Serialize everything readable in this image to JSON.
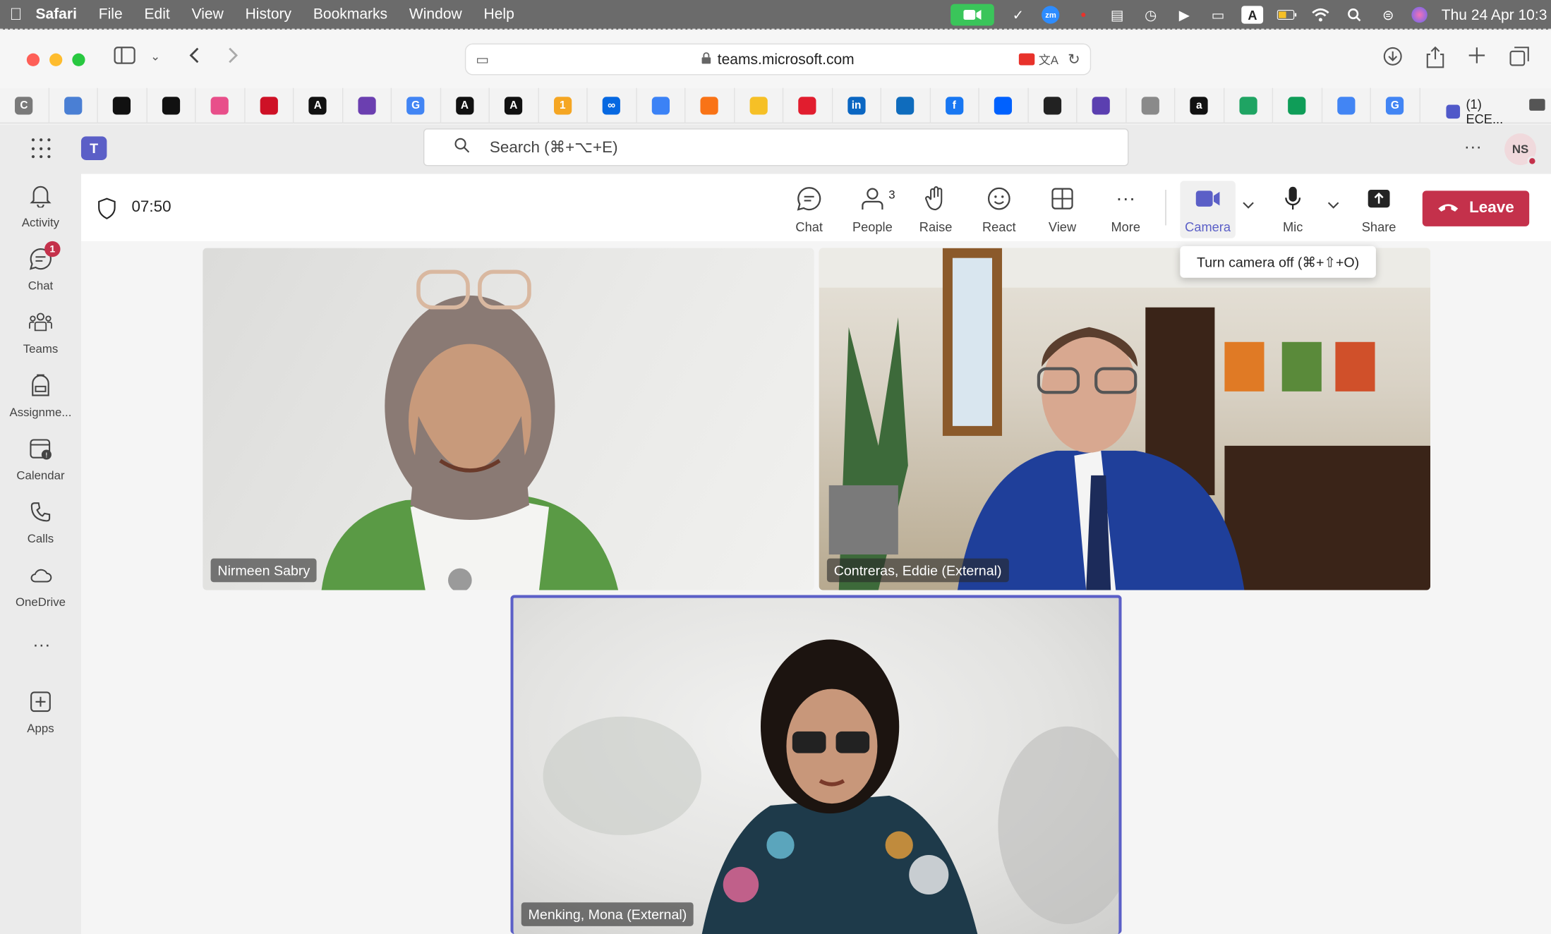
{
  "menubar": {
    "app": "Safari",
    "menus": [
      "File",
      "Edit",
      "View",
      "History",
      "Bookmarks",
      "Window",
      "Help"
    ],
    "zoom_label": "zm",
    "input_source": "A",
    "clock": "Thu 24 Apr 10:3"
  },
  "safari": {
    "url": "teams.microsoft.com",
    "bookmarks": [
      {
        "label": "C",
        "color": "#7a7a7a"
      },
      {
        "label": "",
        "color": "#4a7fd4"
      },
      {
        "label": "",
        "color": "#111111"
      },
      {
        "label": "",
        "color": "#111111"
      },
      {
        "label": "",
        "color": "#e84f8a"
      },
      {
        "label": "",
        "color": "#ce1126"
      },
      {
        "label": "A",
        "color": "#111111"
      },
      {
        "label": "",
        "color": "#6b3fb0"
      },
      {
        "label": "G",
        "color": "#4285f4"
      },
      {
        "label": "A",
        "color": "#111111"
      },
      {
        "label": "A",
        "color": "#111111"
      },
      {
        "label": "1",
        "color": "#f5a623"
      },
      {
        "label": "∞",
        "color": "#0668e1"
      },
      {
        "label": "",
        "color": "#3b82f6"
      },
      {
        "label": "",
        "color": "#f97316"
      },
      {
        "label": "",
        "color": "#f6c026"
      },
      {
        "label": "",
        "color": "#e11d2e"
      },
      {
        "label": "in",
        "color": "#0a66c2"
      },
      {
        "label": "",
        "color": "#0f6cbd"
      },
      {
        "label": "f",
        "color": "#1877f2"
      },
      {
        "label": "",
        "color": "#0061fe"
      },
      {
        "label": "",
        "color": "#222222"
      },
      {
        "label": "",
        "color": "#5b3fb0"
      },
      {
        "label": "",
        "color": "#8a8a8a"
      },
      {
        "label": "a",
        "color": "#111111"
      },
      {
        "label": "",
        "color": "#1fa463"
      },
      {
        "label": "",
        "color": "#0f9d58"
      },
      {
        "label": "",
        "color": "#4285f4"
      },
      {
        "label": "G",
        "color": "#4285f4"
      }
    ],
    "last_tab": "(1) ECE..."
  },
  "teams": {
    "search_placeholder": "Search (⌘+⌥+E)",
    "user_initials": "NS",
    "rail": [
      {
        "label": "Activity",
        "icon": "bell-icon"
      },
      {
        "label": "Chat",
        "icon": "chat-icon",
        "badge": "1"
      },
      {
        "label": "Teams",
        "icon": "teams-icon"
      },
      {
        "label": "Assignme...",
        "icon": "backpack-icon"
      },
      {
        "label": "Calendar",
        "icon": "calendar-icon"
      },
      {
        "label": "Calls",
        "icon": "phone-icon"
      },
      {
        "label": "OneDrive",
        "icon": "cloud-icon"
      },
      {
        "label": "Apps",
        "icon": "apps-plus-icon"
      }
    ]
  },
  "meeting": {
    "timer": "07:50",
    "toolbar": {
      "chat": "Chat",
      "people": "People",
      "people_count": "3",
      "raise": "Raise",
      "react": "React",
      "view": "View",
      "more": "More",
      "camera": "Camera",
      "mic": "Mic",
      "share": "Share",
      "leave": "Leave"
    },
    "tooltip": "Turn camera off (⌘+⇧+O)",
    "participants": [
      {
        "name": "Nirmeen Sabry"
      },
      {
        "name": "Contreras, Eddie (External)"
      },
      {
        "name": "Menking, Mona (External)"
      }
    ]
  },
  "colors": {
    "teams_accent": "#5b5fc7",
    "leave_red": "#c4314b"
  }
}
